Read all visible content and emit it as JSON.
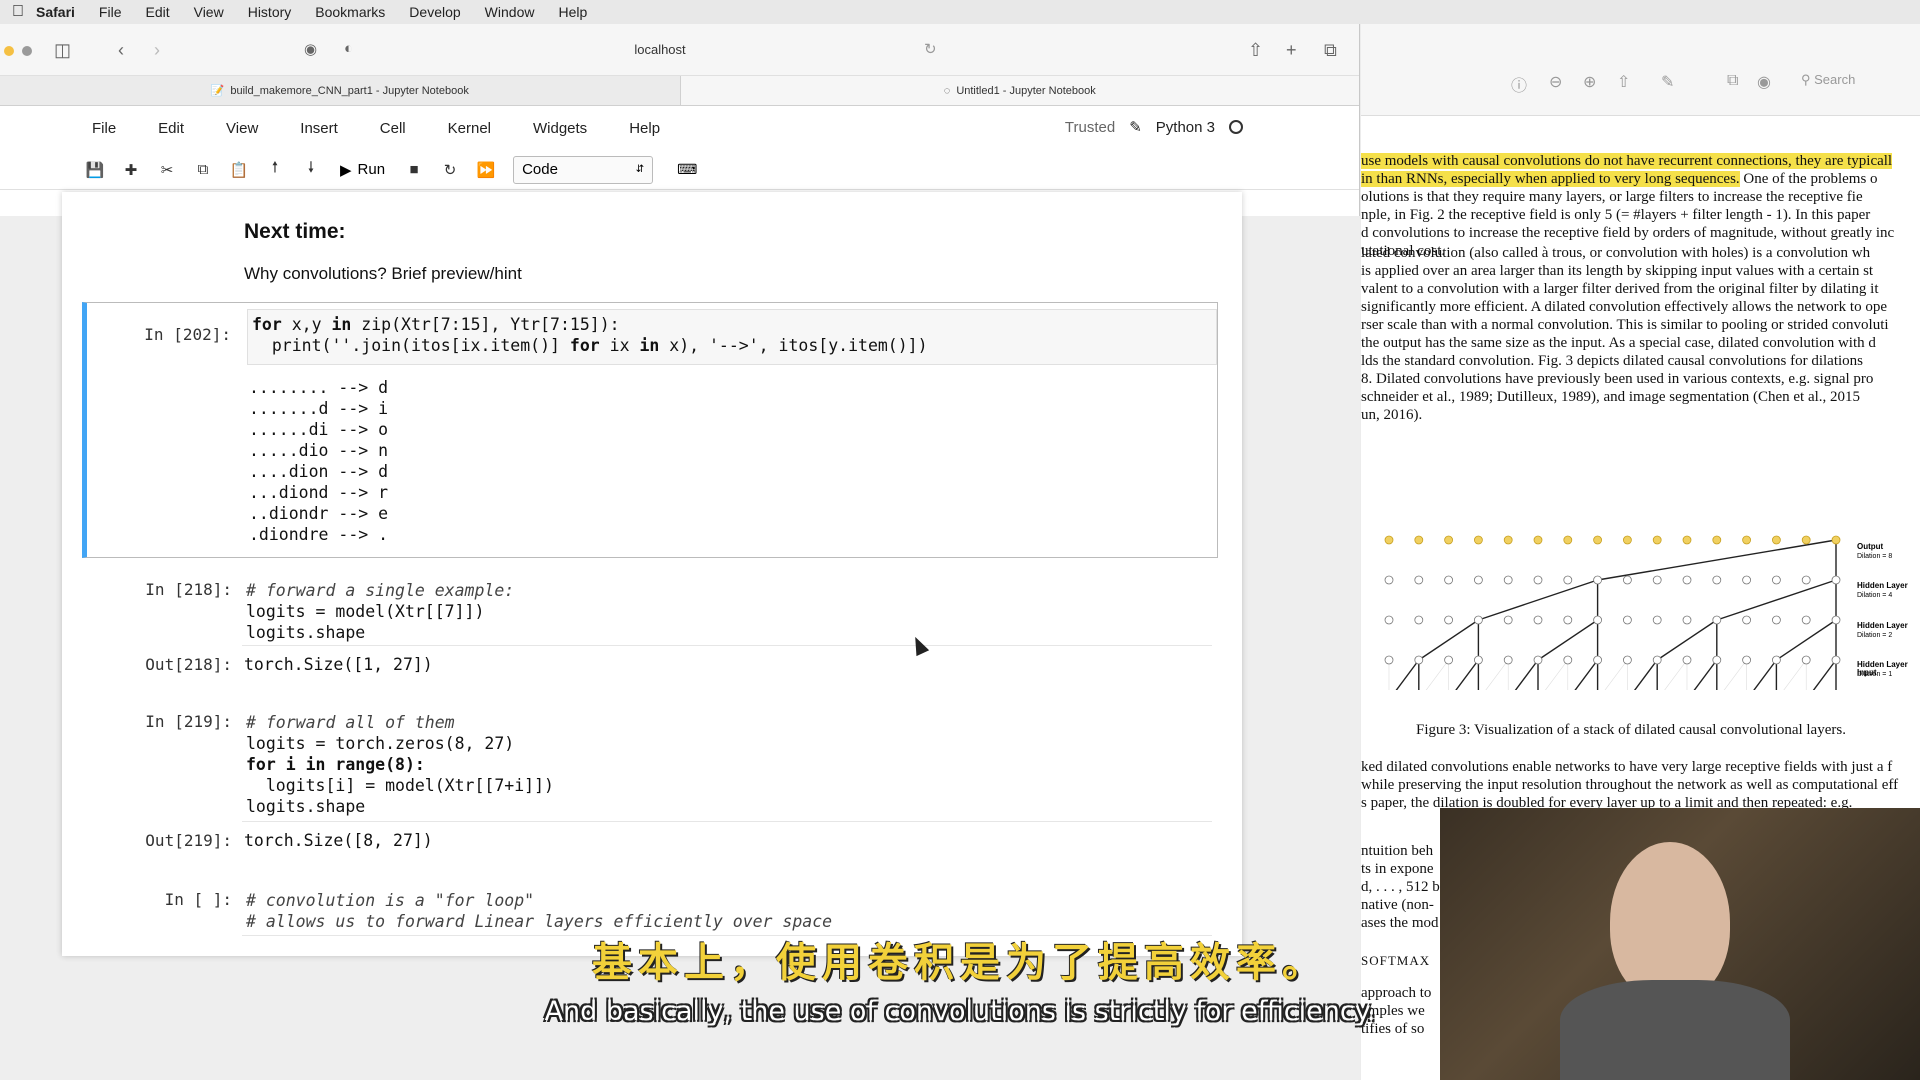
{
  "menubar": {
    "items": [
      "Safari",
      "File",
      "Edit",
      "View",
      "History",
      "Bookmarks",
      "Develop",
      "Window",
      "Help"
    ]
  },
  "safari": {
    "address": "localhost",
    "tabs": [
      {
        "label": "build_makemore_CNN_part1 - Jupyter Notebook"
      },
      {
        "label": "Untitled1 - Jupyter Notebook"
      }
    ]
  },
  "jupyter": {
    "menu": [
      "File",
      "Edit",
      "View",
      "Insert",
      "Cell",
      "Kernel",
      "Widgets",
      "Help"
    ],
    "trusted": "Trusted",
    "kernel": "Python 3",
    "run_label": "Run",
    "cell_type": "Code"
  },
  "notebook": {
    "heading": "Next time:",
    "paragraph": "Why convolutions? Brief preview/hint",
    "cells": [
      {
        "prompt": "In [202]:",
        "code": [
          "for x,y in zip(Xtr[7:15], Ytr[7:15]):",
          "  print(''.join(itos[ix.item()] for ix in x), '-->', itos[y.item()])"
        ],
        "output": [
          "........ --> d",
          ".......d --> i",
          "......di --> o",
          ".....dio --> n",
          "....dion --> d",
          "...diond --> r",
          "..diondr --> e",
          ".diondre --> ."
        ]
      },
      {
        "prompt": "In [218]:",
        "code": [
          "# forward a single example:",
          "logits = model(Xtr[[7]])",
          "logits.shape"
        ],
        "out_prompt": "Out[218]:",
        "output": [
          "torch.Size([1, 27])"
        ]
      },
      {
        "prompt": "In [219]:",
        "code": [
          "# forward all of them",
          "logits = torch.zeros(8, 27)",
          "for i in range(8):",
          "  logits[i] = model(Xtr[[7+i]])",
          "logits.shape"
        ],
        "out_prompt": "Out[219]:",
        "output": [
          "torch.Size([8, 27])"
        ]
      },
      {
        "prompt": "In [ ]:",
        "code": [
          "# convolution is a \"for loop\"",
          "# allows us to forward Linear layers efficiently over space"
        ]
      }
    ]
  },
  "pdf": {
    "toolbar_search": "Search",
    "para1": [
      "use models with causal convolutions do not have recurrent connections, they are typicall",
      "in than RNNs, especially when applied to very long sequences.",
      " One of the problems o",
      "olutions is that they require many layers, or large filters to increase the receptive fie",
      "nple, in Fig. 2 the receptive field is only 5 (= #layers + filter length - 1). In this paper",
      "d convolutions to increase the receptive field by orders of magnitude, without greatly inc",
      "utational cost."
    ],
    "para2": [
      "lated convolution (also called à trous, or convolution with holes) is a convolution wh",
      "is applied over an area larger than its length by skipping input values with a certain st",
      "valent to a convolution with a larger filter derived from the original filter by dilating it",
      "significantly more efficient. A dilated convolution effectively allows the network to ope",
      "rser scale than with a normal convolution. This is similar to pooling or strided convoluti",
      "the output has the same size as the input. As a special case, dilated convolution with d",
      "lds the standard convolution. Fig. 3 depicts dilated causal convolutions for dilations",
      "8. Dilated convolutions have previously been used in various contexts, e.g. signal pro",
      "schneider et al., 1989; Dutilleux, 1989), and image segmentation (Chen et al., 2015",
      "un, 2016)."
    ],
    "layer_labels": [
      "Output",
      "Dilation = 8",
      "Hidden Layer",
      "Dilation = 4",
      "Hidden Layer",
      "Dilation = 2",
      "Hidden Layer",
      "Dilation = 1",
      "Input"
    ],
    "figure_caption": "Figure 3: Visualization of a stack of dilated causal convolutional layers.",
    "para3": [
      "ked dilated convolutions enable networks to have very large receptive fields with just a f",
      "while preserving the input resolution throughout the network as well as computational eff",
      "s paper, the dilation is doubled for every layer up to a limit and then repeated: e.g."
    ],
    "para4": [
      "ntuition beh",
      "ts in expone",
      "d, . . . , 512 b",
      "native (non-",
      "ases the mod"
    ],
    "softmax_heading": "SOFTMAX",
    "para5": [
      "approach to",
      "amples we",
      "tifies of so"
    ]
  },
  "subtitles": {
    "chinese": "基本上，使用卷积是为了提高效率。",
    "english": "And basically, the use of convolutions is strictly for efficiency."
  }
}
